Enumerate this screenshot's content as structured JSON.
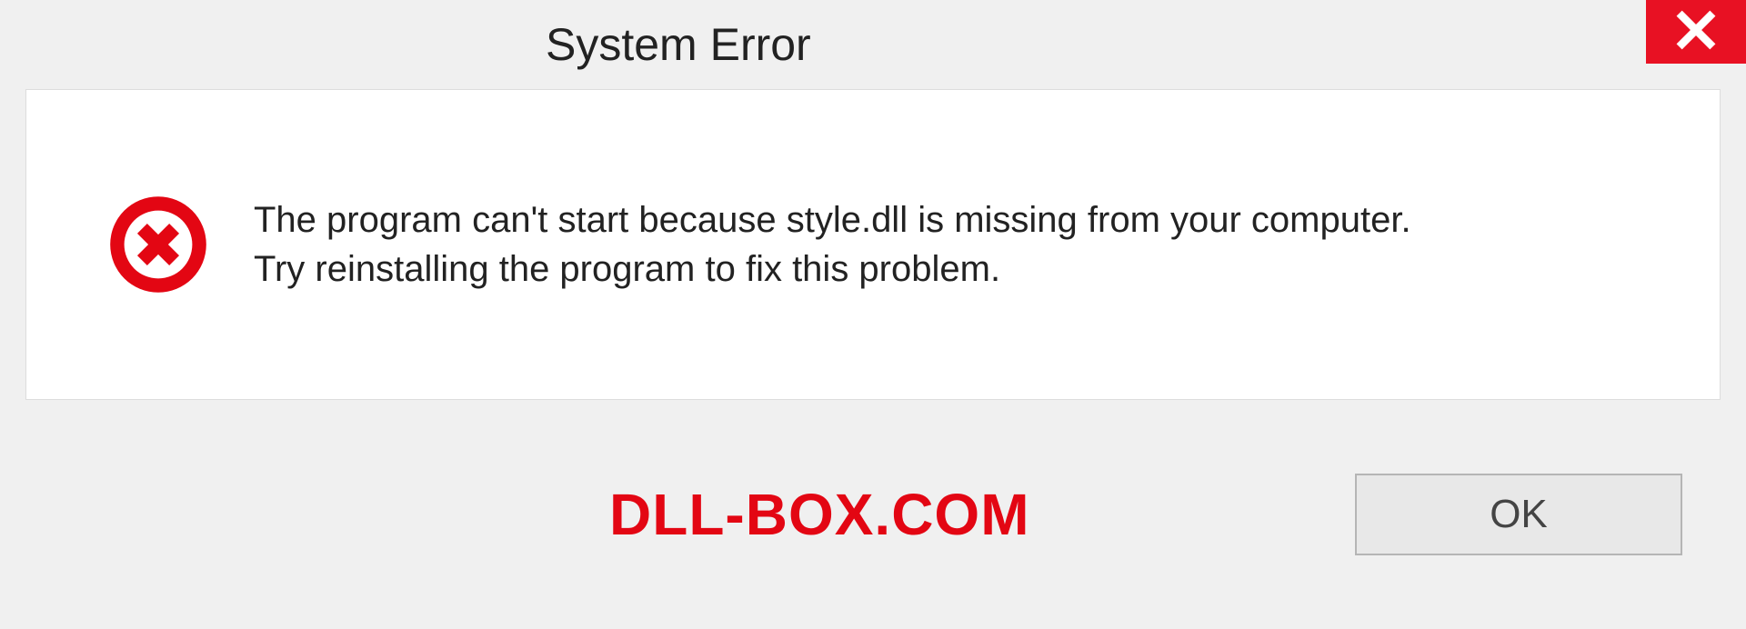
{
  "window": {
    "title": "System Error"
  },
  "message": {
    "line1": "The program can't start because style.dll is missing from your computer.",
    "line2": "Try reinstalling the program to fix this problem."
  },
  "footer": {
    "watermark": "DLL-BOX.COM",
    "ok_label": "OK"
  },
  "colors": {
    "close_bg": "#e81123",
    "watermark": "#e30613"
  }
}
